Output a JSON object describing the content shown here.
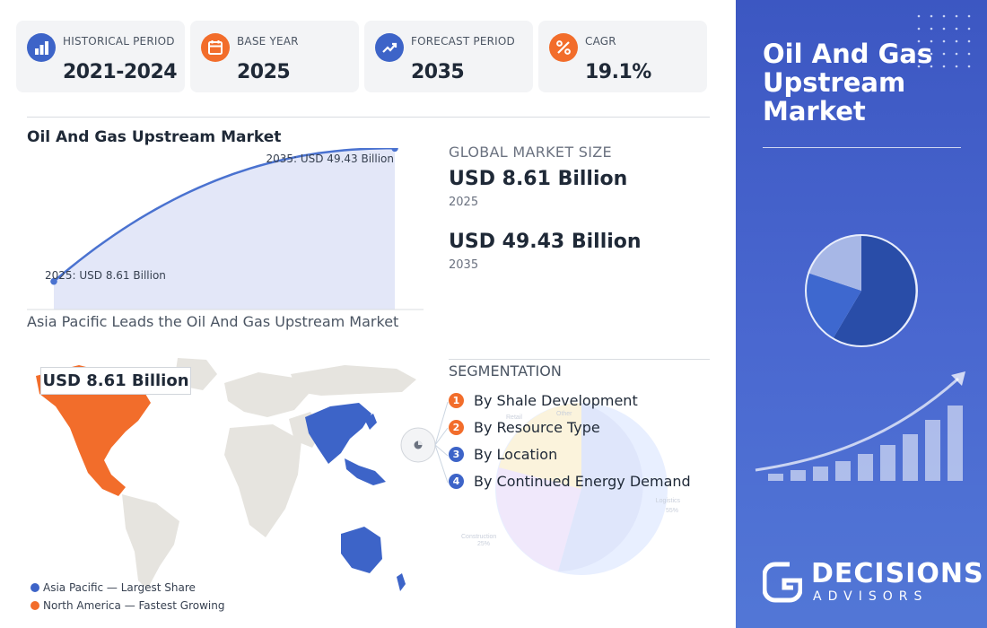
{
  "stats": [
    {
      "label": "HISTORICAL PERIOD",
      "value": "2021-2024",
      "icon": "bar-chart-icon",
      "color": "#3d64c8"
    },
    {
      "label": "BASE YEAR",
      "value": "2025",
      "icon": "calendar-icon",
      "color": "#f26d2b"
    },
    {
      "label": "FORECAST PERIOD",
      "value": "2035",
      "icon": "trend-up-icon",
      "color": "#3d64c8"
    },
    {
      "label": "CAGR",
      "value": "19.1%",
      "icon": "percent-icon",
      "color": "#f26d2b"
    }
  ],
  "chart_data": {
    "type": "area",
    "title": "Oil And Gas Upstream Market",
    "x": [
      2025,
      2035
    ],
    "values": [
      8.61,
      49.43
    ],
    "unit": "USD Billion",
    "annotations": [
      "2025: USD 8.61 Billion",
      "2035: USD 49.43 Billion"
    ],
    "color": "#4a72d0",
    "fill": "#e3e7f8"
  },
  "market": {
    "heading": "GLOBAL MARKET SIZE",
    "base_value": "USD 8.61 Billion",
    "base_year": "2025",
    "forecast_value": "USD 49.43 Billion",
    "forecast_year": "2035"
  },
  "map": {
    "title": "Asia Pacific Leads the Oil And Gas Upstream Market",
    "badge": "USD 8.61 Billion",
    "legend": [
      {
        "label": "Asia Pacific — Largest Share",
        "color": "#3d64c8"
      },
      {
        "label": "North America — Fastest Growing",
        "color": "#f26d2b"
      }
    ]
  },
  "segmentation": {
    "heading": "SEGMENTATION",
    "items": [
      {
        "num": "1",
        "label": "By Shale Development",
        "color": "#f26d2b"
      },
      {
        "num": "2",
        "label": "By Resource Type",
        "color": "#f26d2b"
      },
      {
        "num": "3",
        "label": "By Location",
        "color": "#3d64c8"
      },
      {
        "num": "4",
        "label": "By Continued Energy Demand",
        "color": "#3d64c8"
      }
    ],
    "faint_labels": [
      "Logistics",
      "55%",
      "Construction",
      "25%",
      "Retail",
      "Other"
    ]
  },
  "side": {
    "title": "Oil And Gas Upstream Market",
    "brand_name": "DECISIONS",
    "brand_sub": "ADVISORS"
  }
}
